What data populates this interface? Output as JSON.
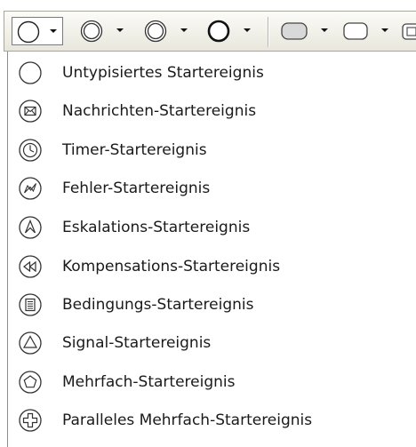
{
  "toolbar": {
    "buttons": [
      {
        "name": "untyped-start-event-button",
        "icon": "circle-thin-icon"
      },
      {
        "name": "intermediate-event-button",
        "icon": "double-circle-icon"
      },
      {
        "name": "intermediate-event-alt-button",
        "icon": "double-circle-icon"
      },
      {
        "name": "end-event-button",
        "icon": "circle-thick-icon"
      },
      {
        "name": "task-button",
        "icon": "rounded-rect-filled-icon"
      },
      {
        "name": "subprocess-button",
        "icon": "rounded-rect-icon"
      },
      {
        "name": "more-button",
        "icon": "partial-icon"
      }
    ]
  },
  "menu": {
    "items": [
      {
        "label": "Untypisiertes Startereignis",
        "icon": "empty-circle-icon"
      },
      {
        "label": "Nachrichten-Startereignis",
        "icon": "envelope-circle-icon"
      },
      {
        "label": "Timer-Startereignis",
        "icon": "clock-circle-icon"
      },
      {
        "label": "Fehler-Startereignis",
        "icon": "lightning-circle-icon"
      },
      {
        "label": "Eskalations-Startereignis",
        "icon": "escalation-circle-icon"
      },
      {
        "label": "Kompensations-Startereignis",
        "icon": "rewind-circle-icon"
      },
      {
        "label": "Bedingungs-Startereignis",
        "icon": "document-circle-icon"
      },
      {
        "label": "Signal-Startereignis",
        "icon": "triangle-circle-icon"
      },
      {
        "label": "Mehrfach-Startereignis",
        "icon": "pentagon-circle-icon"
      },
      {
        "label": "Paralleles Mehrfach-Startereignis",
        "icon": "plus-circle-icon"
      }
    ]
  },
  "colors": {
    "icon_stroke": "#333333",
    "toolbar_bg": "#ece9d8",
    "text": "#1a1a1a"
  }
}
